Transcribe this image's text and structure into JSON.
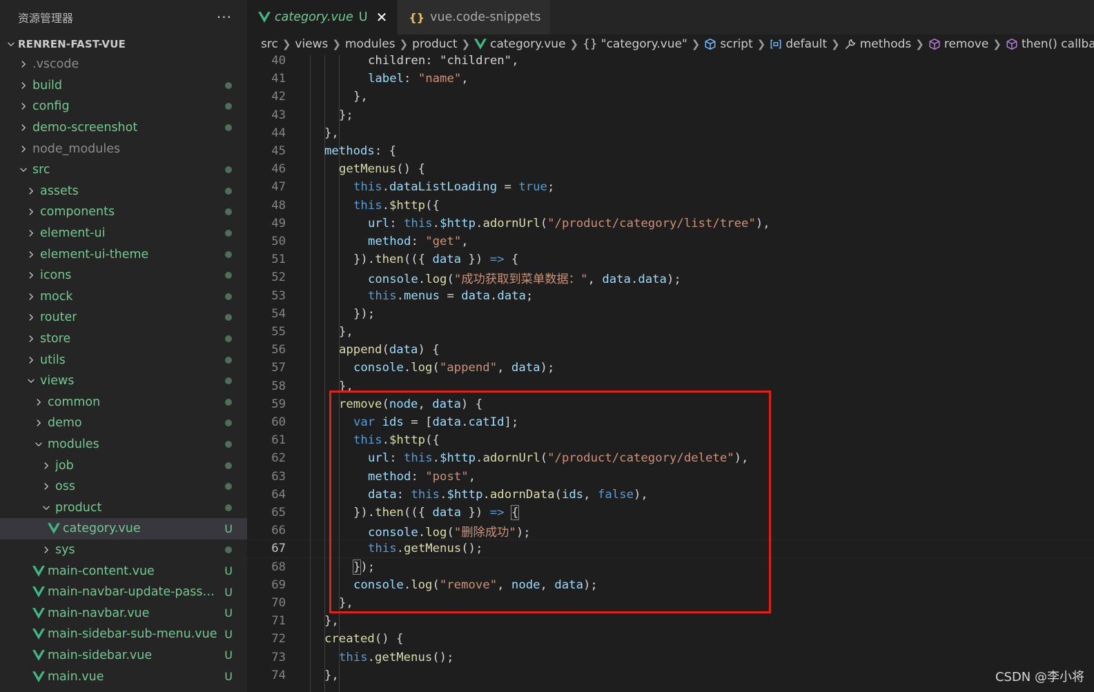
{
  "sidebar": {
    "title": "资源管理器",
    "more": "···",
    "project": "RENREN-FAST-VUE",
    "items": [
      {
        "label": ".vscode",
        "depth": 0,
        "kind": "folder",
        "expanded": false,
        "color": "gray",
        "status": ""
      },
      {
        "label": "build",
        "depth": 0,
        "kind": "folder",
        "expanded": false,
        "color": "green",
        "status": "dot"
      },
      {
        "label": "config",
        "depth": 0,
        "kind": "folder",
        "expanded": false,
        "color": "green",
        "status": "dot"
      },
      {
        "label": "demo-screenshot",
        "depth": 0,
        "kind": "folder",
        "expanded": false,
        "color": "green",
        "status": "dot"
      },
      {
        "label": "node_modules",
        "depth": 0,
        "kind": "folder",
        "expanded": false,
        "color": "gray",
        "status": ""
      },
      {
        "label": "src",
        "depth": 0,
        "kind": "folder",
        "expanded": true,
        "color": "green",
        "status": "dot"
      },
      {
        "label": "assets",
        "depth": 1,
        "kind": "folder",
        "expanded": false,
        "color": "green",
        "status": "dot"
      },
      {
        "label": "components",
        "depth": 1,
        "kind": "folder",
        "expanded": false,
        "color": "green",
        "status": "dot"
      },
      {
        "label": "element-ui",
        "depth": 1,
        "kind": "folder",
        "expanded": false,
        "color": "green",
        "status": "dot"
      },
      {
        "label": "element-ui-theme",
        "depth": 1,
        "kind": "folder",
        "expanded": false,
        "color": "green",
        "status": "dot"
      },
      {
        "label": "icons",
        "depth": 1,
        "kind": "folder",
        "expanded": false,
        "color": "green",
        "status": "dot"
      },
      {
        "label": "mock",
        "depth": 1,
        "kind": "folder",
        "expanded": false,
        "color": "green",
        "status": "dot"
      },
      {
        "label": "router",
        "depth": 1,
        "kind": "folder",
        "expanded": false,
        "color": "green",
        "status": "dot"
      },
      {
        "label": "store",
        "depth": 1,
        "kind": "folder",
        "expanded": false,
        "color": "green",
        "status": "dot"
      },
      {
        "label": "utils",
        "depth": 1,
        "kind": "folder",
        "expanded": false,
        "color": "green",
        "status": "dot"
      },
      {
        "label": "views",
        "depth": 1,
        "kind": "folder",
        "expanded": true,
        "color": "green",
        "status": "dot"
      },
      {
        "label": "common",
        "depth": 2,
        "kind": "folder",
        "expanded": false,
        "color": "green",
        "status": "dot"
      },
      {
        "label": "demo",
        "depth": 2,
        "kind": "folder",
        "expanded": false,
        "color": "green",
        "status": "dot"
      },
      {
        "label": "modules",
        "depth": 2,
        "kind": "folder",
        "expanded": true,
        "color": "green",
        "status": "dot"
      },
      {
        "label": "job",
        "depth": 3,
        "kind": "folder",
        "expanded": false,
        "color": "green",
        "status": "dot"
      },
      {
        "label": "oss",
        "depth": 3,
        "kind": "folder",
        "expanded": false,
        "color": "green",
        "status": "dot"
      },
      {
        "label": "product",
        "depth": 3,
        "kind": "folder",
        "expanded": true,
        "color": "green",
        "status": "dot"
      },
      {
        "label": "category.vue",
        "depth": 4,
        "kind": "vue",
        "expanded": false,
        "color": "green",
        "status": "U",
        "selected": true
      },
      {
        "label": "sys",
        "depth": 3,
        "kind": "folder",
        "expanded": false,
        "color": "green",
        "status": "dot"
      },
      {
        "label": "main-content.vue",
        "depth": 2,
        "kind": "vue",
        "expanded": false,
        "color": "green",
        "status": "U"
      },
      {
        "label": "main-navbar-update-passwo...",
        "depth": 2,
        "kind": "vue",
        "expanded": false,
        "color": "green",
        "status": "U"
      },
      {
        "label": "main-navbar.vue",
        "depth": 2,
        "kind": "vue",
        "expanded": false,
        "color": "green",
        "status": "U"
      },
      {
        "label": "main-sidebar-sub-menu.vue",
        "depth": 2,
        "kind": "vue",
        "expanded": false,
        "color": "green",
        "status": "U"
      },
      {
        "label": "main-sidebar.vue",
        "depth": 2,
        "kind": "vue",
        "expanded": false,
        "color": "green",
        "status": "U"
      },
      {
        "label": "main.vue",
        "depth": 2,
        "kind": "vue",
        "expanded": false,
        "color": "green",
        "status": "U"
      }
    ]
  },
  "tabs": [
    {
      "label": "category.vue",
      "badge": "U",
      "active": true,
      "icon": "vue-icon",
      "close": "✕"
    },
    {
      "label": "vue.code-snippets",
      "active": false,
      "icon": "braces-icon"
    }
  ],
  "breadcrumb": [
    {
      "label": "src",
      "icon": ""
    },
    {
      "label": "views",
      "icon": ""
    },
    {
      "label": "modules",
      "icon": ""
    },
    {
      "label": "product",
      "icon": ""
    },
    {
      "label": "category.vue",
      "icon": "vue-icon"
    },
    {
      "label": "\"category.vue\"",
      "icon": "braces-icon"
    },
    {
      "label": "script",
      "icon": "module-icon"
    },
    {
      "label": "default",
      "icon": "variable-icon"
    },
    {
      "label": "methods",
      "icon": "wrench-icon"
    },
    {
      "label": "remove",
      "icon": "method-icon"
    },
    {
      "label": "then() callback",
      "icon": "method-icon"
    }
  ],
  "code": {
    "active_line": 67,
    "lines": [
      {
        "n": "40",
        "indent": 3,
        "tokens": [
          [
            "p",
            "children: \"children\","
          ]
        ]
      },
      {
        "n": "41",
        "indent": 3,
        "tokens": [
          [
            "prop",
            "label"
          ],
          [
            "p",
            ": "
          ],
          [
            "str",
            "\"name\""
          ],
          [
            "p",
            ","
          ]
        ]
      },
      {
        "n": "42",
        "indent": 2,
        "tokens": [
          [
            "p",
            "},"
          ]
        ]
      },
      {
        "n": "43",
        "indent": 1,
        "tokens": [
          [
            "p",
            "};"
          ]
        ]
      },
      {
        "n": "44",
        "indent": 0,
        "tokens": [
          [
            "p",
            "},"
          ]
        ]
      },
      {
        "n": "45",
        "indent": 0,
        "tokens": [
          [
            "prop",
            "methods"
          ],
          [
            "p",
            ": {"
          ]
        ]
      },
      {
        "n": "46",
        "indent": 1,
        "tokens": [
          [
            "fn",
            "getMenus"
          ],
          [
            "p",
            "() {"
          ]
        ]
      },
      {
        "n": "47",
        "indent": 2,
        "tokens": [
          [
            "kw",
            "this"
          ],
          [
            "p",
            "."
          ],
          [
            "prop",
            "dataListLoading"
          ],
          [
            "p",
            " = "
          ],
          [
            "kw",
            "true"
          ],
          [
            "p",
            ";"
          ]
        ]
      },
      {
        "n": "48",
        "indent": 2,
        "tokens": [
          [
            "kw",
            "this"
          ],
          [
            "p",
            "."
          ],
          [
            "fn",
            "$http"
          ],
          [
            "p",
            "({"
          ]
        ]
      },
      {
        "n": "49",
        "indent": 3,
        "tokens": [
          [
            "prop",
            "url"
          ],
          [
            "p",
            ": "
          ],
          [
            "kw",
            "this"
          ],
          [
            "p",
            "."
          ],
          [
            "prop",
            "$http"
          ],
          [
            "p",
            "."
          ],
          [
            "fn",
            "adornUrl"
          ],
          [
            "p",
            "("
          ],
          [
            "str",
            "\"/product/category/list/tree\""
          ],
          [
            "p",
            "),"
          ]
        ]
      },
      {
        "n": "50",
        "indent": 3,
        "tokens": [
          [
            "prop",
            "method"
          ],
          [
            "p",
            ": "
          ],
          [
            "str",
            "\"get\""
          ],
          [
            "p",
            ","
          ]
        ]
      },
      {
        "n": "51",
        "indent": 2,
        "tokens": [
          [
            "p",
            "})."
          ],
          [
            "fn",
            "then"
          ],
          [
            "p",
            "(({ "
          ],
          [
            "prop",
            "data"
          ],
          [
            "p",
            " }) "
          ],
          [
            "kw",
            "=>"
          ],
          [
            "p",
            " {"
          ]
        ]
      },
      {
        "n": "52",
        "indent": 3,
        "tokens": [
          [
            "prop",
            "console"
          ],
          [
            "p",
            "."
          ],
          [
            "fn",
            "log"
          ],
          [
            "p",
            "("
          ],
          [
            "str",
            "\"成功获取到菜单数据：\""
          ],
          [
            "p",
            ", "
          ],
          [
            "prop",
            "data"
          ],
          [
            "p",
            "."
          ],
          [
            "prop",
            "data"
          ],
          [
            "p",
            ");"
          ]
        ]
      },
      {
        "n": "53",
        "indent": 3,
        "tokens": [
          [
            "kw",
            "this"
          ],
          [
            "p",
            "."
          ],
          [
            "prop",
            "menus"
          ],
          [
            "p",
            " = "
          ],
          [
            "prop",
            "data"
          ],
          [
            "p",
            "."
          ],
          [
            "prop",
            "data"
          ],
          [
            "p",
            ";"
          ]
        ]
      },
      {
        "n": "54",
        "indent": 2,
        "tokens": [
          [
            "p",
            "});"
          ]
        ]
      },
      {
        "n": "55",
        "indent": 1,
        "tokens": [
          [
            "p",
            "},"
          ]
        ]
      },
      {
        "n": "56",
        "indent": 1,
        "tokens": [
          [
            "fn",
            "append"
          ],
          [
            "p",
            "("
          ],
          [
            "prop",
            "data"
          ],
          [
            "p",
            ") {"
          ]
        ]
      },
      {
        "n": "57",
        "indent": 2,
        "tokens": [
          [
            "prop",
            "console"
          ],
          [
            "p",
            "."
          ],
          [
            "fn",
            "log"
          ],
          [
            "p",
            "("
          ],
          [
            "str",
            "\"append\""
          ],
          [
            "p",
            ", "
          ],
          [
            "prop",
            "data"
          ],
          [
            "p",
            ");"
          ]
        ]
      },
      {
        "n": "58",
        "indent": 1,
        "tokens": [
          [
            "p",
            "},"
          ]
        ]
      },
      {
        "n": "59",
        "indent": 1,
        "tokens": [
          [
            "fn",
            "remove"
          ],
          [
            "p",
            "("
          ],
          [
            "prop",
            "node"
          ],
          [
            "p",
            ", "
          ],
          [
            "prop",
            "data"
          ],
          [
            "p",
            ") {"
          ]
        ]
      },
      {
        "n": "60",
        "indent": 2,
        "tokens": [
          [
            "kw",
            "var"
          ],
          [
            "p",
            " "
          ],
          [
            "prop",
            "ids"
          ],
          [
            "p",
            " = ["
          ],
          [
            "prop",
            "data"
          ],
          [
            "p",
            "."
          ],
          [
            "prop",
            "catId"
          ],
          [
            "p",
            "];"
          ]
        ]
      },
      {
        "n": "61",
        "indent": 2,
        "tokens": [
          [
            "kw",
            "this"
          ],
          [
            "p",
            "."
          ],
          [
            "fn",
            "$http"
          ],
          [
            "p",
            "({"
          ]
        ]
      },
      {
        "n": "62",
        "indent": 3,
        "tokens": [
          [
            "prop",
            "url"
          ],
          [
            "p",
            ": "
          ],
          [
            "kw",
            "this"
          ],
          [
            "p",
            "."
          ],
          [
            "prop",
            "$http"
          ],
          [
            "p",
            "."
          ],
          [
            "fn",
            "adornUrl"
          ],
          [
            "p",
            "("
          ],
          [
            "str",
            "\"/product/category/delete\""
          ],
          [
            "p",
            "),"
          ]
        ]
      },
      {
        "n": "63",
        "indent": 3,
        "tokens": [
          [
            "prop",
            "method"
          ],
          [
            "p",
            ": "
          ],
          [
            "str",
            "\"post\""
          ],
          [
            "p",
            ","
          ]
        ]
      },
      {
        "n": "64",
        "indent": 3,
        "tokens": [
          [
            "prop",
            "data"
          ],
          [
            "p",
            ": "
          ],
          [
            "kw",
            "this"
          ],
          [
            "p",
            "."
          ],
          [
            "prop",
            "$http"
          ],
          [
            "p",
            "."
          ],
          [
            "fn",
            "adornData"
          ],
          [
            "p",
            "("
          ],
          [
            "prop",
            "ids"
          ],
          [
            "p",
            ", "
          ],
          [
            "kw",
            "false"
          ],
          [
            "p",
            "),"
          ]
        ]
      },
      {
        "n": "65",
        "indent": 2,
        "tokens": [
          [
            "p",
            "})."
          ],
          [
            "fn",
            "then"
          ],
          [
            "p",
            "(({ "
          ],
          [
            "prop",
            "data"
          ],
          [
            "p",
            " }) "
          ],
          [
            "kw",
            "=>"
          ],
          [
            "p",
            " "
          ],
          [
            "box",
            "{"
          ]
        ]
      },
      {
        "n": "66",
        "indent": 3,
        "tokens": [
          [
            "prop",
            "console"
          ],
          [
            "p",
            "."
          ],
          [
            "fn",
            "log"
          ],
          [
            "p",
            "("
          ],
          [
            "str",
            "\"删除成功\""
          ],
          [
            "p",
            ");"
          ]
        ]
      },
      {
        "n": "67",
        "indent": 3,
        "tokens": [
          [
            "kw",
            "this"
          ],
          [
            "p",
            "."
          ],
          [
            "fn",
            "getMenus"
          ],
          [
            "p",
            "();"
          ]
        ]
      },
      {
        "n": "68",
        "indent": 2,
        "tokens": [
          [
            "box",
            "}"
          ],
          [
            "p",
            ");"
          ]
        ]
      },
      {
        "n": "69",
        "indent": 2,
        "tokens": [
          [
            "prop",
            "console"
          ],
          [
            "p",
            "."
          ],
          [
            "fn",
            "log"
          ],
          [
            "p",
            "("
          ],
          [
            "str",
            "\"remove\""
          ],
          [
            "p",
            ", "
          ],
          [
            "prop",
            "node"
          ],
          [
            "p",
            ", "
          ],
          [
            "prop",
            "data"
          ],
          [
            "p",
            ");"
          ]
        ]
      },
      {
        "n": "70",
        "indent": 1,
        "tokens": [
          [
            "p",
            "},"
          ]
        ]
      },
      {
        "n": "71",
        "indent": 0,
        "tokens": [
          [
            "p",
            "},"
          ]
        ]
      },
      {
        "n": "72",
        "indent": 0,
        "tokens": [
          [
            "fn",
            "created"
          ],
          [
            "p",
            "() {"
          ]
        ]
      },
      {
        "n": "73",
        "indent": 1,
        "tokens": [
          [
            "kw",
            "this"
          ],
          [
            "p",
            "."
          ],
          [
            "fn",
            "getMenus"
          ],
          [
            "p",
            "();"
          ]
        ]
      },
      {
        "n": "74",
        "indent": 0,
        "tokens": [
          [
            "p",
            "},"
          ]
        ]
      }
    ]
  },
  "watermark": "CSDN @李小将",
  "colors": {
    "accent_red": "#e0201b",
    "git_untracked": "#73c991",
    "editor_bg": "#1e1e1e",
    "sidebar_bg": "#252526"
  }
}
